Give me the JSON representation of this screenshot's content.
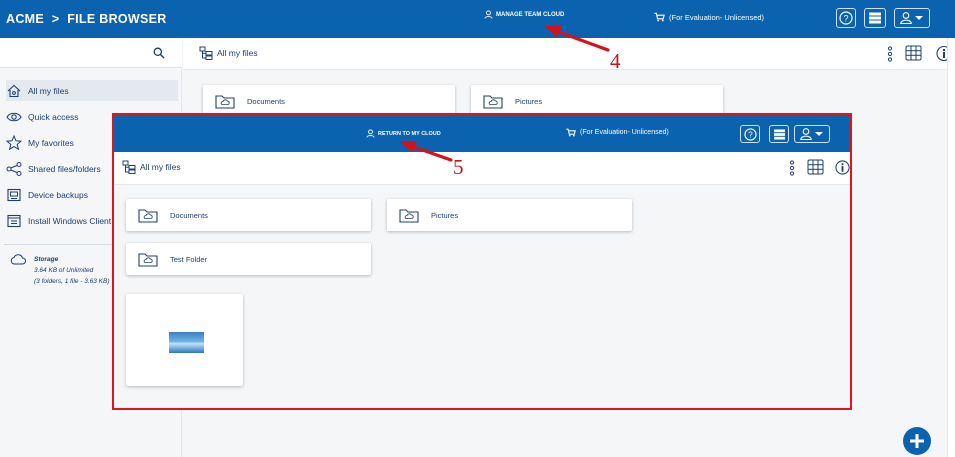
{
  "topbar": {
    "brand": "ACME",
    "brand_sep": ">",
    "brand_page": "FILE BROWSER",
    "manage_label": "MANAGE TEAM CLOUD",
    "evaluation_label": "(For Evaluation- Unlicensed)"
  },
  "sidebar": {
    "items": [
      {
        "label": "All my files",
        "icon": "home-icon"
      },
      {
        "label": "Quick access",
        "icon": "eye-icon"
      },
      {
        "label": "My favorites",
        "icon": "star-icon"
      },
      {
        "label": "Shared files/folders",
        "icon": "share-icon"
      },
      {
        "label": "Device backups",
        "icon": "backup-icon"
      },
      {
        "label": "Install Windows Client",
        "icon": "windows-icon"
      }
    ],
    "storage_title": "Storage",
    "storage_usage": "3.64 KB of Unlimited",
    "storage_detail": "(3 folders, 1 file - 3.63 KB)"
  },
  "main": {
    "breadcrumb": "All my files",
    "folders": [
      "Documents",
      "Pictures"
    ]
  },
  "overlay": {
    "return_label": "RETURN TO MY CLOUD",
    "evaluation_label": "(For Evaluation- Unlicensed)",
    "breadcrumb": "All my files",
    "folders": [
      "Documents",
      "Pictures",
      "Test Folder"
    ]
  },
  "annotations": {
    "step_4": "4",
    "step_5": "5"
  },
  "colors": {
    "brand_blue": "#0b62ae",
    "highlight_red": "#e0141b",
    "text": "#1f3f6e"
  }
}
